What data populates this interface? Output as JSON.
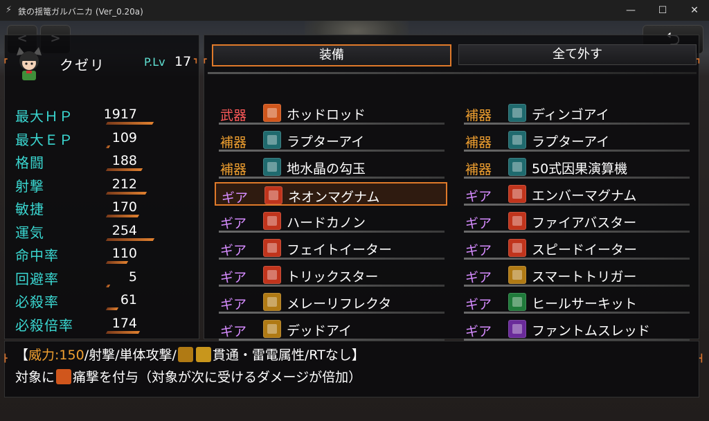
{
  "window": {
    "title": "鉄の揺篭ガルバニカ (Ver_0.20a)",
    "minimize": "—",
    "maximize": "☐",
    "close": "✕"
  },
  "nav": {
    "prev": "<",
    "next": ">",
    "back": "⮌"
  },
  "character": {
    "name": "クゼリ",
    "plv_label": "P.Lv",
    "plv": "17"
  },
  "stats": [
    {
      "label": "最大ＨＰ",
      "value": "1917"
    },
    {
      "label": "最大ＥＰ",
      "value": "109"
    },
    {
      "label": "格闘",
      "value": "188"
    },
    {
      "label": "射撃",
      "value": "212"
    },
    {
      "label": "敏捷",
      "value": "170"
    },
    {
      "label": "運気",
      "value": "254"
    },
    {
      "label": "命中率",
      "value": "110"
    },
    {
      "label": "回避率",
      "value": "5"
    },
    {
      "label": "必殺率",
      "value": "61"
    },
    {
      "label": "必殺倍率",
      "value": "174"
    }
  ],
  "tabs": {
    "equip": "装備",
    "remove_all": "全て外す"
  },
  "left_slots": [
    {
      "category": "武器",
      "name": "ホッドロッド",
      "cat_color": "#ff5a5a",
      "icon_color": "#d0561c",
      "selected": false
    },
    {
      "category": "補器",
      "name": "ラプターアイ",
      "cat_color": "#f0a030",
      "icon_color": "#1f6a6e",
      "selected": false
    },
    {
      "category": "補器",
      "name": "地水晶の勾玉",
      "cat_color": "#f0a030",
      "icon_color": "#1f6a6e",
      "selected": false
    },
    {
      "category": "ギア",
      "name": "ネオンマグナム",
      "cat_color": "#d68cff",
      "icon_color": "#c0341c",
      "selected": true
    },
    {
      "category": "ギア",
      "name": "ハードカノン",
      "cat_color": "#d68cff",
      "icon_color": "#c0341c",
      "selected": false
    },
    {
      "category": "ギア",
      "name": "フェイトイーター",
      "cat_color": "#d68cff",
      "icon_color": "#c0341c",
      "selected": false
    },
    {
      "category": "ギア",
      "name": "トリックスター",
      "cat_color": "#d68cff",
      "icon_color": "#c0341c",
      "selected": false
    },
    {
      "category": "ギア",
      "name": "メレーリフレクタ",
      "cat_color": "#d68cff",
      "icon_color": "#b07a14",
      "selected": false
    },
    {
      "category": "ギア",
      "name": "デッドアイ",
      "cat_color": "#d68cff",
      "icon_color": "#b07a14",
      "selected": false
    }
  ],
  "right_slots": [
    {
      "category": "補器",
      "name": "ディンゴアイ",
      "cat_color": "#f0a030",
      "icon_color": "#1f6a6e"
    },
    {
      "category": "補器",
      "name": "ラプターアイ",
      "cat_color": "#f0a030",
      "icon_color": "#1f6a6e"
    },
    {
      "category": "補器",
      "name": "50式因果演算機",
      "cat_color": "#f0a030",
      "icon_color": "#1f6a6e"
    },
    {
      "category": "ギア",
      "name": "エンバーマグナム",
      "cat_color": "#d68cff",
      "icon_color": "#c0341c"
    },
    {
      "category": "ギア",
      "name": "ファイアバスター",
      "cat_color": "#d68cff",
      "icon_color": "#c0341c"
    },
    {
      "category": "ギア",
      "name": "スピードイーター",
      "cat_color": "#d68cff",
      "icon_color": "#c0341c"
    },
    {
      "category": "ギア",
      "name": "スマートトリガー",
      "cat_color": "#d68cff",
      "icon_color": "#b07a14"
    },
    {
      "category": "ギア",
      "name": "ヒールサーキット",
      "cat_color": "#d68cff",
      "icon_color": "#1f7a3a"
    },
    {
      "category": "ギア",
      "name": "ファントムスレッド",
      "cat_color": "#d68cff",
      "icon_color": "#6a2a9a"
    }
  ],
  "description": {
    "open": "【",
    "power_label": "威力:150",
    "line1_rest_a": "/射撃/単体攻撃/",
    "line1_rest_b": "貫通・雷電属性/RTなし】",
    "line2_a": "対象に",
    "line2_b": "痛撃を付与（対象が次に受けるダメージが倍加）"
  }
}
